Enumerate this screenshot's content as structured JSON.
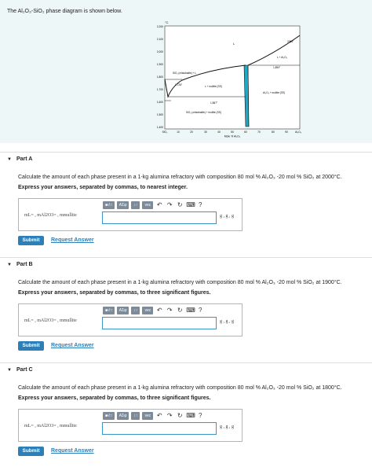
{
  "intro": {
    "text": "The Al₂O₃-SiO₂   phase diagram is shown below."
  },
  "diagram": {
    "y_unit": "°C",
    "y_ticks": [
      "2,200",
      "2,100",
      "2,000",
      "1,900",
      "1,800",
      "1,700",
      "1,600",
      "1,500",
      "1,400"
    ],
    "x_ticks": [
      "SiO₂",
      "10",
      "20",
      "30",
      "40",
      "50",
      "60",
      "70",
      "80",
      "90",
      "Al₂O₃"
    ],
    "x_label": "Mole % Al₂O₃",
    "labels": {
      "L": "L",
      "temp_2054": "2054°",
      "l_al2o3": "L + Al₂O₃",
      "temp_1890": "1,890°",
      "sio2_l": "SiO₂ (cristobalite) + L",
      "temp_1726": "1,726°",
      "l_mullite": "L + mullite (SS)",
      "al2o3_mullite": "Al₂O₃ + mullite (SS)",
      "temp_1587": "1,587°",
      "sio2_mullite": "SiO₂ (cristobalite) + mullite (SS)"
    },
    "colors": {
      "liquidus": "#111111",
      "mullite_region": "#1ea9c6",
      "background": "#ffffff"
    }
  },
  "common": {
    "toolbar": {
      "templates": "■√□",
      "symbols": "ΑΣφ",
      "arrows": "↕↑",
      "vec": "vec",
      "undo": "↶",
      "redo": "↷",
      "reset": "↻",
      "keyboard": "⌨",
      "help": "?"
    },
    "var_label": "mL= , mAl2O3= , mmullite",
    "units": "g , g , g",
    "submit": "Submit",
    "request": "Request Answer"
  },
  "parts": [
    {
      "title": "Part A",
      "question": "Calculate the amount of each phase present in a 1-kg alumina refractory with composition 80 mol % Al₂O₃ -20 mol % SiO₂ at 2000°C.",
      "instruction": "Express your answers, separated by commas, to nearest integer."
    },
    {
      "title": "Part B",
      "question": "Calculate the amount of each phase present in a 1-kg alumina refractory with composition 80 mol % Al₂O₃ -20 mol % SiO₂ at 1900°C.",
      "instruction": "Express your answers, separated by commas, to three significant figures."
    },
    {
      "title": "Part C",
      "question": "Calculate the amount of each phase present in a 1-kg alumina refractory with composition 80 mol % Al₂O₃ -20 mol % SiO₂ at 1800°C.",
      "instruction": "Express your answers, separated by commas, to three significant figures."
    }
  ]
}
